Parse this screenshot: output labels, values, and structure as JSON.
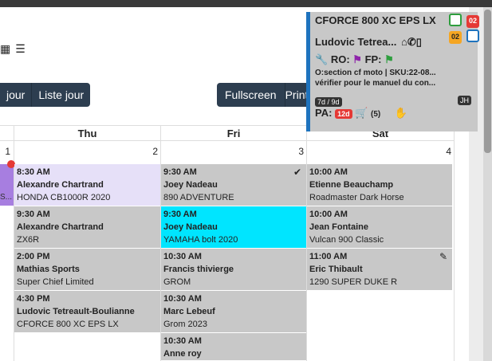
{
  "toolbar": {
    "day_btn_partial": "jour",
    "list_day_btn": "Liste jour",
    "fullscreen_btn": "Fullscreen",
    "print_btn_partial": "Print"
  },
  "calendar": {
    "headers": [
      "Thu",
      "Fri",
      "Sat"
    ],
    "daynums": [
      "1",
      "2",
      "3",
      "4"
    ],
    "prev_col_partial": "S...",
    "events": {
      "thu": [
        {
          "time": "8:30 AM",
          "name": "Alexandre Chartrand",
          "vehicle": "HONDA CB1000R 2020"
        },
        {
          "time": "9:30 AM",
          "name": "Alexandre Chartrand",
          "vehicle": "ZX6R"
        },
        {
          "time": "2:00 PM",
          "name": "Mathias Sports",
          "vehicle": "Super Chief Limited"
        },
        {
          "time": "4:30 PM",
          "name": "Ludovic Tetreault-Boulianne",
          "vehicle": "CFORCE 800 XC EPS LX"
        }
      ],
      "fri": [
        {
          "time": "9:30 AM",
          "name": "Joey Nadeau",
          "vehicle": "890 ADVENTURE"
        },
        {
          "time": "9:30 AM",
          "name": "Joey Nadeau",
          "vehicle": "YAMAHA bolt 2020"
        },
        {
          "time": "10:30 AM",
          "name": "Francis thivierge",
          "vehicle": "GROM"
        },
        {
          "time": "10:30 AM",
          "name": "Marc Lebeuf",
          "vehicle": "Grom 2023"
        },
        {
          "time": "10:30 AM",
          "name": "Anne roy",
          "vehicle": ""
        }
      ],
      "sat": [
        {
          "time": "10:00 AM",
          "name": "Etienne Beauchamp",
          "vehicle": "Roadmaster Dark Horse"
        },
        {
          "time": "10:00 AM",
          "name": "Jean Fontaine",
          "vehicle": "Vulcan 900 Classic"
        },
        {
          "time": "11:00 AM",
          "name": "Eric Thibault",
          "vehicle": "1290 SUPER DUKE R"
        }
      ]
    }
  },
  "popup": {
    "title": "CFORCE 800 XC EPS LX",
    "owner": "Ludovic Tetrea...",
    "ro_label": "RO:",
    "fp_label": "FP:",
    "section_line": "O:section cf moto | SKU:22-08...",
    "note_line": "vérifier pour le manuel du con...",
    "days_tag": "7d / 9d",
    "initials": "JH",
    "pa_label": "PA:",
    "pa_days": "12d",
    "cart_count": "(5)",
    "badge_top": "02",
    "badge_mid": "02",
    "colors": {
      "border": "#1e73be",
      "ro_flag": "#8e24aa",
      "fp_flag": "#2e9e3e",
      "wrench": "#e53935"
    }
  }
}
